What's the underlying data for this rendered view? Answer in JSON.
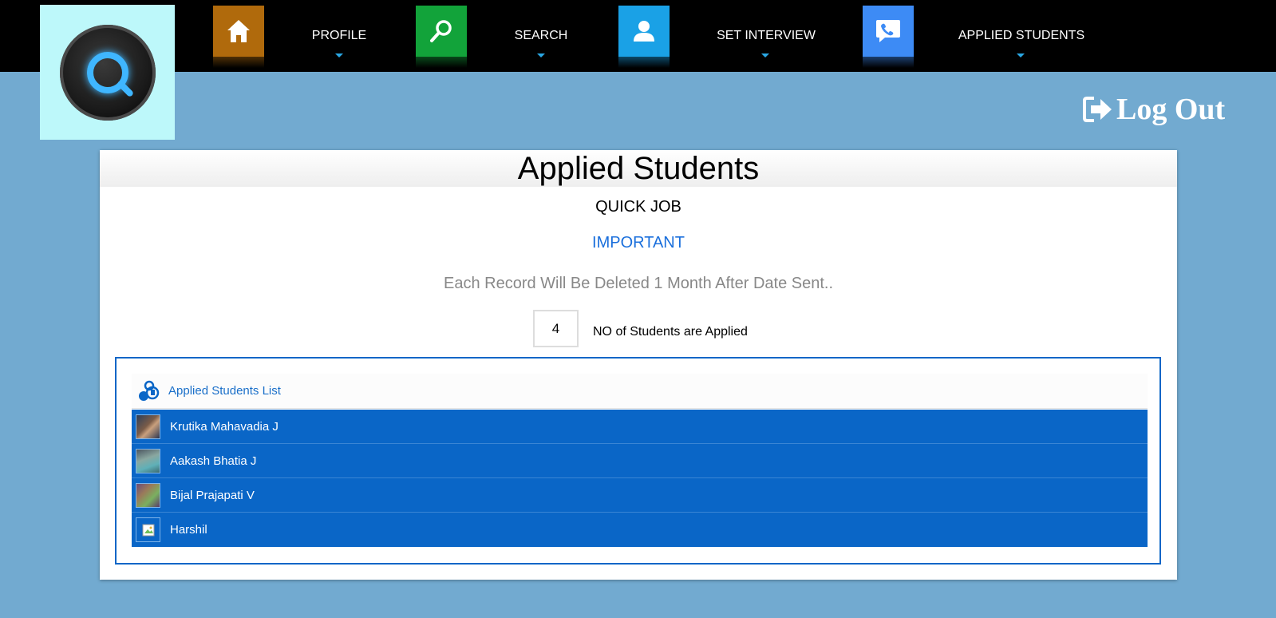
{
  "nav": {
    "items": [
      {
        "label": "PROFILE",
        "icon": "home-icon",
        "color": "#b06a0c"
      },
      {
        "label": "SEARCH",
        "icon": "search-icon",
        "color": "#12a33a"
      },
      {
        "label": "SET INTERVIEW",
        "icon": "user-icon",
        "color": "#1aa1e6"
      },
      {
        "label": "APPLIED STUDENTS",
        "icon": "phone-icon",
        "color": "#3d8bf5"
      }
    ]
  },
  "header": {
    "logout_label": "Log Out"
  },
  "main": {
    "title": "Applied Students",
    "company": "QUICK JOB",
    "important": "IMPORTANT",
    "note": "Each Record Will Be Deleted 1 Month After Date Sent..",
    "count": "4",
    "count_label": "NO of Students are Applied",
    "list_title": "Applied Students List",
    "students": [
      {
        "name": "Krutika Mahavadia J"
      },
      {
        "name": "Aakash Bhatia J"
      },
      {
        "name": "Bijal Prajapati V"
      },
      {
        "name": "Harshil"
      }
    ]
  },
  "colors": {
    "accent": "#0a66c7",
    "background": "#72aad0",
    "topbar": "#000000"
  }
}
